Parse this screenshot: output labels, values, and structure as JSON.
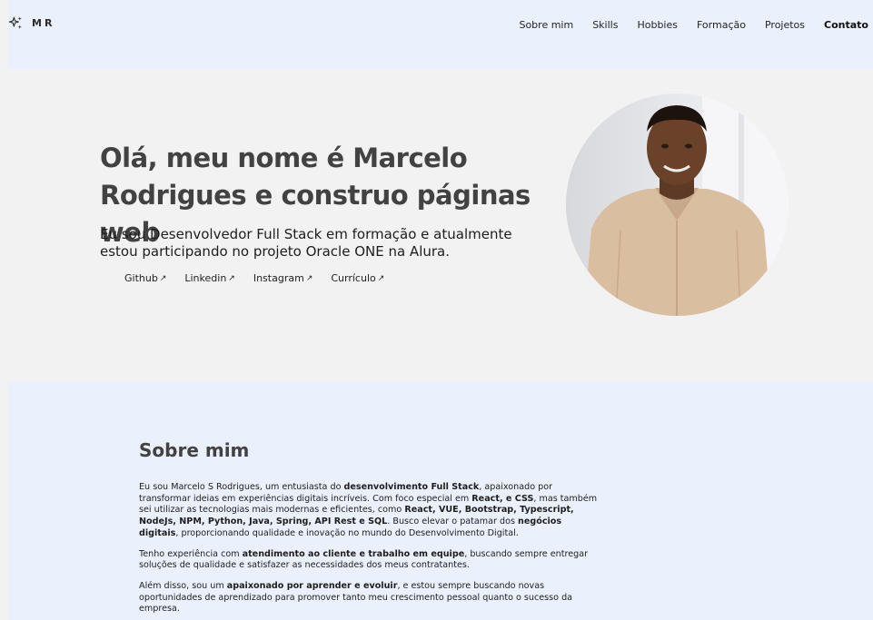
{
  "header": {
    "logo_text": "MR",
    "nav": [
      {
        "label": "Sobre mim"
      },
      {
        "label": "Skills"
      },
      {
        "label": "Hobbies"
      },
      {
        "label": "Formação"
      },
      {
        "label": "Projetos"
      },
      {
        "label": "Contato",
        "active": true
      }
    ]
  },
  "hero": {
    "title_line1": "Olá, meu nome é Marcelo",
    "title_line2": "Rodrigues e construo páginas web",
    "subtitle": "Eu sou Desenvolvedor Full Stack em formação e atualmente estou participando no projeto Oracle ONE na Alura.",
    "links": [
      {
        "label": "Github",
        "arrow": "↗"
      },
      {
        "label": "Linkedin",
        "arrow": "↗"
      },
      {
        "label": "Instagram",
        "arrow": "↗"
      },
      {
        "label": "Currículo",
        "arrow": "↗"
      }
    ],
    "photo_icon": "profile-photo"
  },
  "about": {
    "title": "Sobre mim",
    "p1": [
      {
        "t": "Eu sou Marcelo S Rodrigues, um entusiasta do "
      },
      {
        "t": "desenvolvimento Full Stack",
        "b": true
      },
      {
        "t": ", apaixonado por transformar ideias em experiências digitais incríveis. Com foco especial em "
      },
      {
        "t": "React, e CSS",
        "b": true
      },
      {
        "t": ", mas também sei utilizar as tecnologias mais modernas e eficientes, como "
      },
      {
        "t": "React, VUE, Bootstrap, Typescript, NodeJs, NPM, Python, Java, Spring, API Rest e SQL",
        "b": true
      },
      {
        "t": ". Busco elevar o patamar dos "
      },
      {
        "t": "negócios digitais",
        "b": true
      },
      {
        "t": ", proporcionando qualidade e inovação no mundo do Desenvolvimento Digital."
      }
    ],
    "p2": [
      {
        "t": "Tenho experiência com "
      },
      {
        "t": "atendimento ao cliente e trabalho em equipe",
        "b": true
      },
      {
        "t": ", buscando sempre entregar soluções de qualidade e satisfazer as necessidades dos meus contratantes."
      }
    ],
    "p3": [
      {
        "t": "Além disso, sou um "
      },
      {
        "t": "apaixonado por aprender e evoluir",
        "b": true
      },
      {
        "t": ", e estou sempre buscando novas oportunidades de aprendizado para promover tanto meu crescimento pessoal quanto o sucesso da empresa."
      }
    ]
  }
}
